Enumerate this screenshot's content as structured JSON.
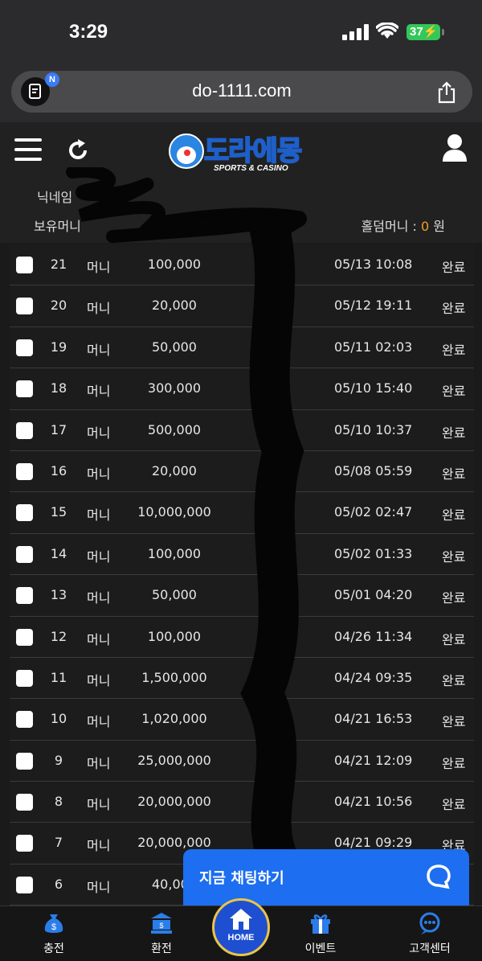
{
  "status_bar": {
    "time": "3:29",
    "battery": "37"
  },
  "browser": {
    "url": "do-1111.com",
    "ext_badge": "N"
  },
  "header": {
    "logo_text": "도라에몽",
    "logo_sub": "SPORTS & CASINO",
    "nickname_label": "닉네임",
    "money_label": "보유머니",
    "hold_money_label": "홀덤머니 : ",
    "hold_money_value": "0",
    "hold_money_unit": " 원"
  },
  "rows": [
    {
      "no": "21",
      "type": "머니",
      "amount": "100,000",
      "date": "05/13 10:08",
      "status": "완료"
    },
    {
      "no": "20",
      "type": "머니",
      "amount": "20,000",
      "date": "05/12 19:11",
      "status": "완료"
    },
    {
      "no": "19",
      "type": "머니",
      "amount": "50,000",
      "date": "05/11 02:03",
      "status": "완료"
    },
    {
      "no": "18",
      "type": "머니",
      "amount": "300,000",
      "date": "05/10 15:40",
      "status": "완료"
    },
    {
      "no": "17",
      "type": "머니",
      "amount": "500,000",
      "date": "05/10 10:37",
      "status": "완료"
    },
    {
      "no": "16",
      "type": "머니",
      "amount": "20,000",
      "date": "05/08 05:59",
      "status": "완료"
    },
    {
      "no": "15",
      "type": "머니",
      "amount": "10,000,000",
      "date": "05/02 02:47",
      "status": "완료"
    },
    {
      "no": "14",
      "type": "머니",
      "amount": "100,000",
      "date": "05/02 01:33",
      "status": "완료"
    },
    {
      "no": "13",
      "type": "머니",
      "amount": "50,000",
      "date": "05/01 04:20",
      "status": "완료"
    },
    {
      "no": "12",
      "type": "머니",
      "amount": "100,000",
      "date": "04/26 11:34",
      "status": "완료"
    },
    {
      "no": "11",
      "type": "머니",
      "amount": "1,500,000",
      "date": "04/24 09:35",
      "status": "완료"
    },
    {
      "no": "10",
      "type": "머니",
      "amount": "1,020,000",
      "date": "04/21 16:53",
      "status": "완료"
    },
    {
      "no": "9",
      "type": "머니",
      "amount": "25,000,000",
      "date": "04/21 12:09",
      "status": "완료"
    },
    {
      "no": "8",
      "type": "머니",
      "amount": "20,000,000",
      "date": "04/21 10:56",
      "status": "완료"
    },
    {
      "no": "7",
      "type": "머니",
      "amount": "20,000,000",
      "date": "04/21 09:29",
      "status": "완료"
    },
    {
      "no": "6",
      "type": "머니",
      "amount": "40,000",
      "date": "",
      "status": ""
    }
  ],
  "chat": {
    "label": "지금 채팅하기"
  },
  "nav": {
    "deposit": "충전",
    "withdraw": "환전",
    "home": "HOME",
    "event": "이벤트",
    "support": "고객센터"
  },
  "colors": {
    "accent": "#1d6ef0",
    "hold_money": "#f0a020",
    "battery": "#34c759"
  }
}
